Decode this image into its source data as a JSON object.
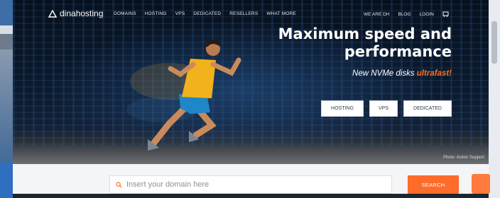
{
  "brand": {
    "name": "dinahosting"
  },
  "nav": {
    "items": [
      "DOMAINS",
      "HOSTING",
      "VPS",
      "DEDICATED",
      "RESELLERS",
      "WHAT MORE"
    ],
    "right_items": [
      "WE ARE DH",
      "BLOG",
      "LOGIN"
    ]
  },
  "hero": {
    "headline": "Maximum speed and performance",
    "sub_prefix": "New NVMe disks ",
    "sub_accent": "ultrafast!",
    "buttons": [
      "HOSTING",
      "VPS",
      "DEDICATED"
    ],
    "photo_credit": "Photo: Action Support"
  },
  "search": {
    "placeholder": "Insert your domain here",
    "button_label": "SEARCH"
  },
  "colors": {
    "accent": "#ff6b2b",
    "hero_bg": "#0c1a2e",
    "runner_shirt": "#f2b21b",
    "runner_shorts": "#1f86c8"
  },
  "icons": [
    "logo-triangle-icon",
    "cart-icon",
    "search-icon",
    "chat-icon"
  ]
}
